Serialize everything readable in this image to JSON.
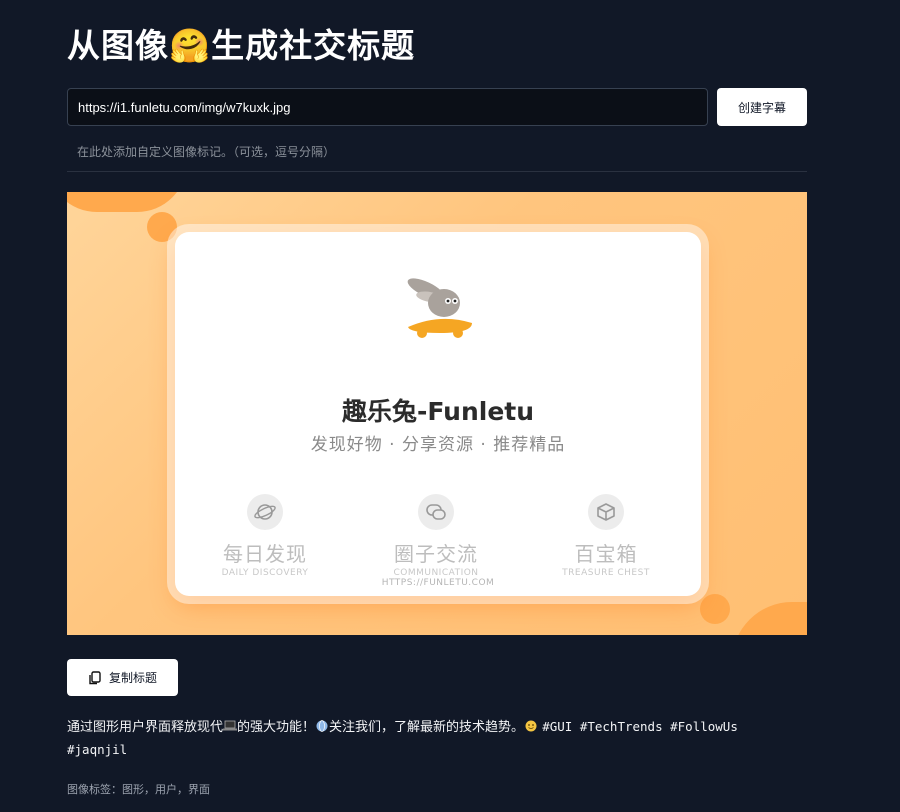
{
  "page": {
    "title": "从图像🤗生成社交标题"
  },
  "form": {
    "url_value": "https://i1.funletu.com/img/w7kuxk.jpg",
    "create_button": "创建字幕",
    "tags_placeholder": "在此处添加自定义图像标记。（可选，逗号分隔）"
  },
  "preview": {
    "brand": "趣乐兔-Funletu",
    "slogan": "发现好物 · 分享资源 · 推荐精品",
    "features": [
      {
        "title": "每日发现",
        "subtitle": "DAILY DISCOVERY",
        "icon": "planet-icon"
      },
      {
        "title": "圈子交流",
        "subtitle": "COMMUNICATION",
        "icon": "chat-bubbles-icon"
      },
      {
        "title": "百宝箱",
        "subtitle": "TREASURE CHEST",
        "icon": "box-icon"
      }
    ],
    "url": "HTTPS://FUNLETU.COM",
    "colors": {
      "background": "#ffc57e",
      "accent": "#ffa94d"
    }
  },
  "actions": {
    "copy_button": "复制标题"
  },
  "caption": {
    "part1": "通过图形用户界面释放现代",
    "part2": "的强大功能！",
    "part3": "关注我们，了解最新的技术趋势。",
    "hashtags_line1": "#GUI #TechTrends #FollowUs",
    "hashtags_line2": "#jaqnjil"
  },
  "image_tags": "图像标签：图形，用户，界面"
}
